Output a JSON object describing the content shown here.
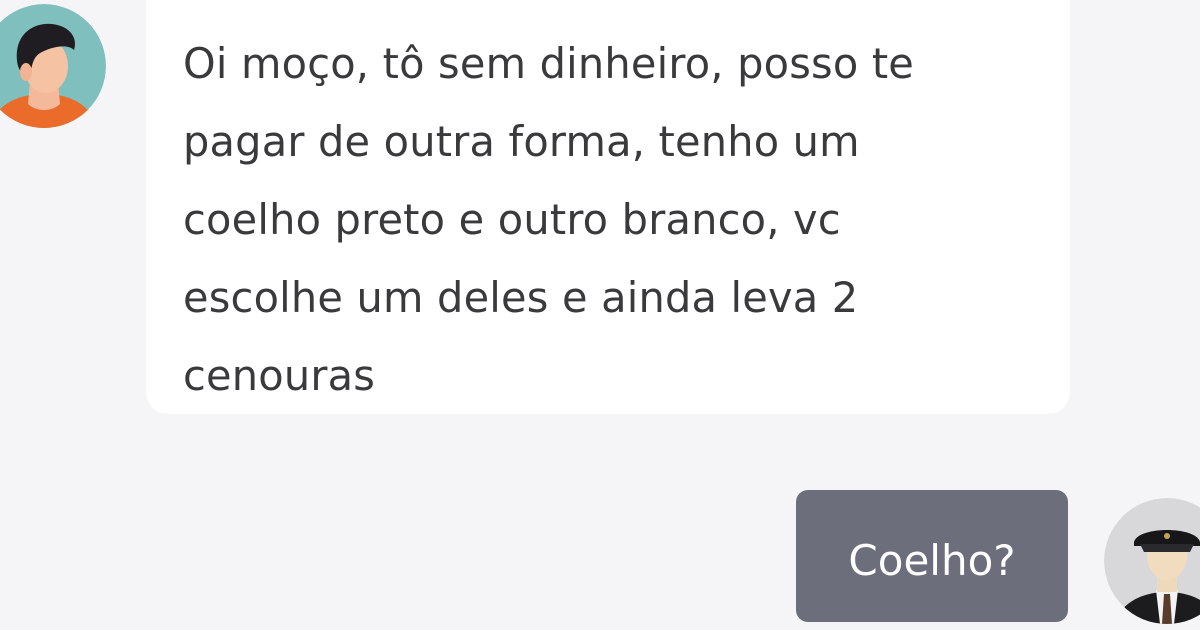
{
  "conversation": {
    "messages": [
      {
        "sender": "customer",
        "text": "Oi moço, tô sem dinheiro, posso te pagar de outra forma, tenho um coelho preto e outro branco, vc escolhe um deles e ainda leva 2 cenouras",
        "lines": [
          "Oi moço, tô sem dinheiro, posso te",
          "pagar de outra forma, tenho um",
          "coelho preto e outro branco, vc",
          "escolhe um deles e ainda leva 2",
          "cenouras"
        ],
        "avatar_icon": "young-man-avatar-icon"
      },
      {
        "sender": "driver",
        "text": "Coelho?",
        "avatar_icon": "driver-cap-avatar-icon"
      }
    ]
  },
  "colors": {
    "background": "#f5f5f7",
    "incoming_bubble": "#ffffff",
    "outgoing_bubble": "#6d6e7c",
    "incoming_text": "#3a3a3c",
    "outgoing_text": "#ffffff"
  }
}
